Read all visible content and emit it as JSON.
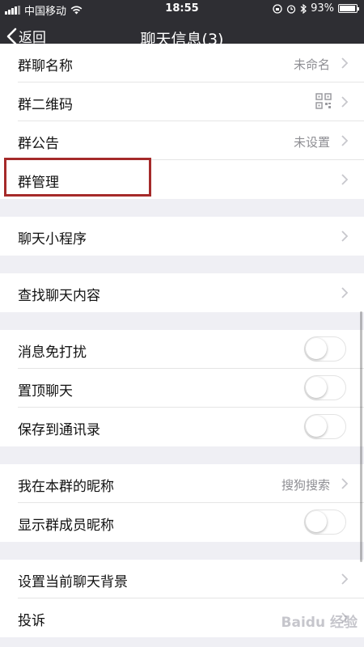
{
  "status_bar": {
    "carrier": "中国移动",
    "time": "18:55",
    "battery": "93%",
    "battery_level": 0.93,
    "icons": [
      "signal-icon",
      "wifi-icon",
      "lock-rotation-icon",
      "alarm-icon",
      "bluetooth-icon",
      "battery-icon"
    ]
  },
  "nav": {
    "back_label": "返回",
    "title": "聊天信息(3)"
  },
  "sections": {
    "group_info": {
      "name_label": "群聊名称",
      "name_value": "未命名",
      "qrcode_label": "群二维码",
      "notice_label": "群公告",
      "notice_value": "未设置",
      "manage_label": "群管理"
    },
    "mini_program": {
      "label": "聊天小程序"
    },
    "search": {
      "label": "查找聊天内容"
    },
    "settings": {
      "mute_label": "消息免打扰",
      "mute_on": false,
      "pin_label": "置顶聊天",
      "pin_on": false,
      "save_label": "保存到通讯录",
      "save_on": false
    },
    "nickname": {
      "my_nick_label": "我在本群的昵称",
      "my_nick_value": "搜狗搜索",
      "show_nick_label": "显示群成员昵称",
      "show_nick_on": false
    },
    "misc": {
      "background_label": "设置当前聊天背景",
      "report_label": "投诉"
    }
  },
  "watermark": "Baidu 经验",
  "colors": {
    "nav_bg": "#2e2e33",
    "page_bg": "#efeff4",
    "highlight": "#a52a2a"
  }
}
